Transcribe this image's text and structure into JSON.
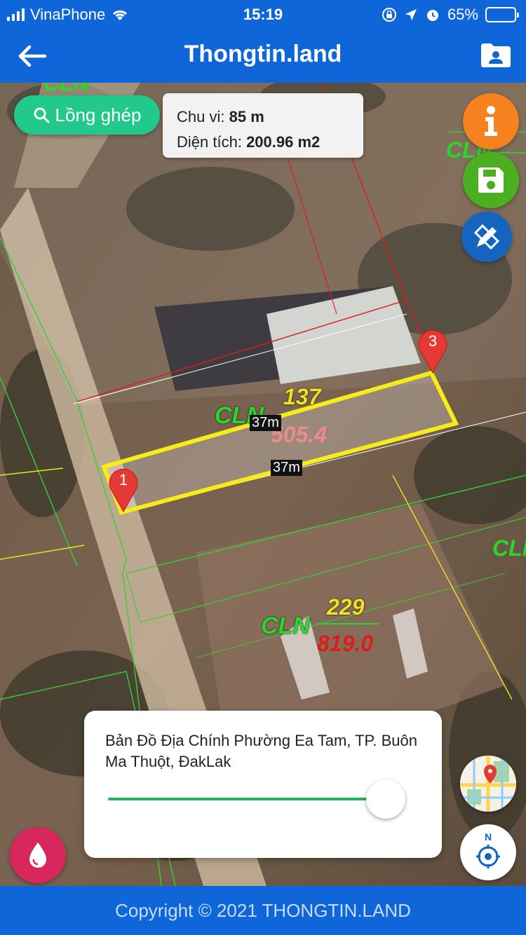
{
  "status_bar": {
    "carrier": "VinaPhone",
    "time": "15:19",
    "battery": "65%",
    "battery_level": 0.65
  },
  "header": {
    "title": "Thongtin.land"
  },
  "map": {
    "overlap_label": "Lồng ghép",
    "measure": {
      "perimeter_label": "Chu vi:",
      "perimeter_value": "85 m",
      "area_label": "Diện tích:",
      "area_value": "200.96 m2"
    },
    "parcels": [
      {
        "land_type": "CLN",
        "number": "137",
        "area": "505.4"
      },
      {
        "land_type": "CLN",
        "number": "229",
        "area": "819.0"
      }
    ],
    "edge_labels": [
      "37m",
      "37m"
    ],
    "markers": [
      "1",
      "3"
    ],
    "partial_labels": [
      "CLN",
      "CLN",
      "CLN"
    ],
    "colors": {
      "land_type": "#2bd62b",
      "parcel_number": "#f2e21e",
      "parcel_area_current": "#f08a8a",
      "parcel_area_other": "#e01b1b",
      "selection": "#f7ec18",
      "marker": "#e53935"
    }
  },
  "layer": {
    "name": "Bản Đồ Địa Chính Phường Ea Tam, TP. Buôn Ma Thuột, ĐakLak",
    "opacity": 0.9
  },
  "controls": {
    "info_icon": "info-icon",
    "save_icon": "floppy-disk-icon",
    "edit_icon": "pencil-ruler-icon",
    "drop_icon": "water-drop-icon",
    "map_style_icon": "map-thumbnail-icon",
    "compass_icon": "compass-north-icon",
    "compass_letter": "N"
  },
  "footer": {
    "copyright": "Copyright © 2021 THONGTIN.LAND"
  }
}
